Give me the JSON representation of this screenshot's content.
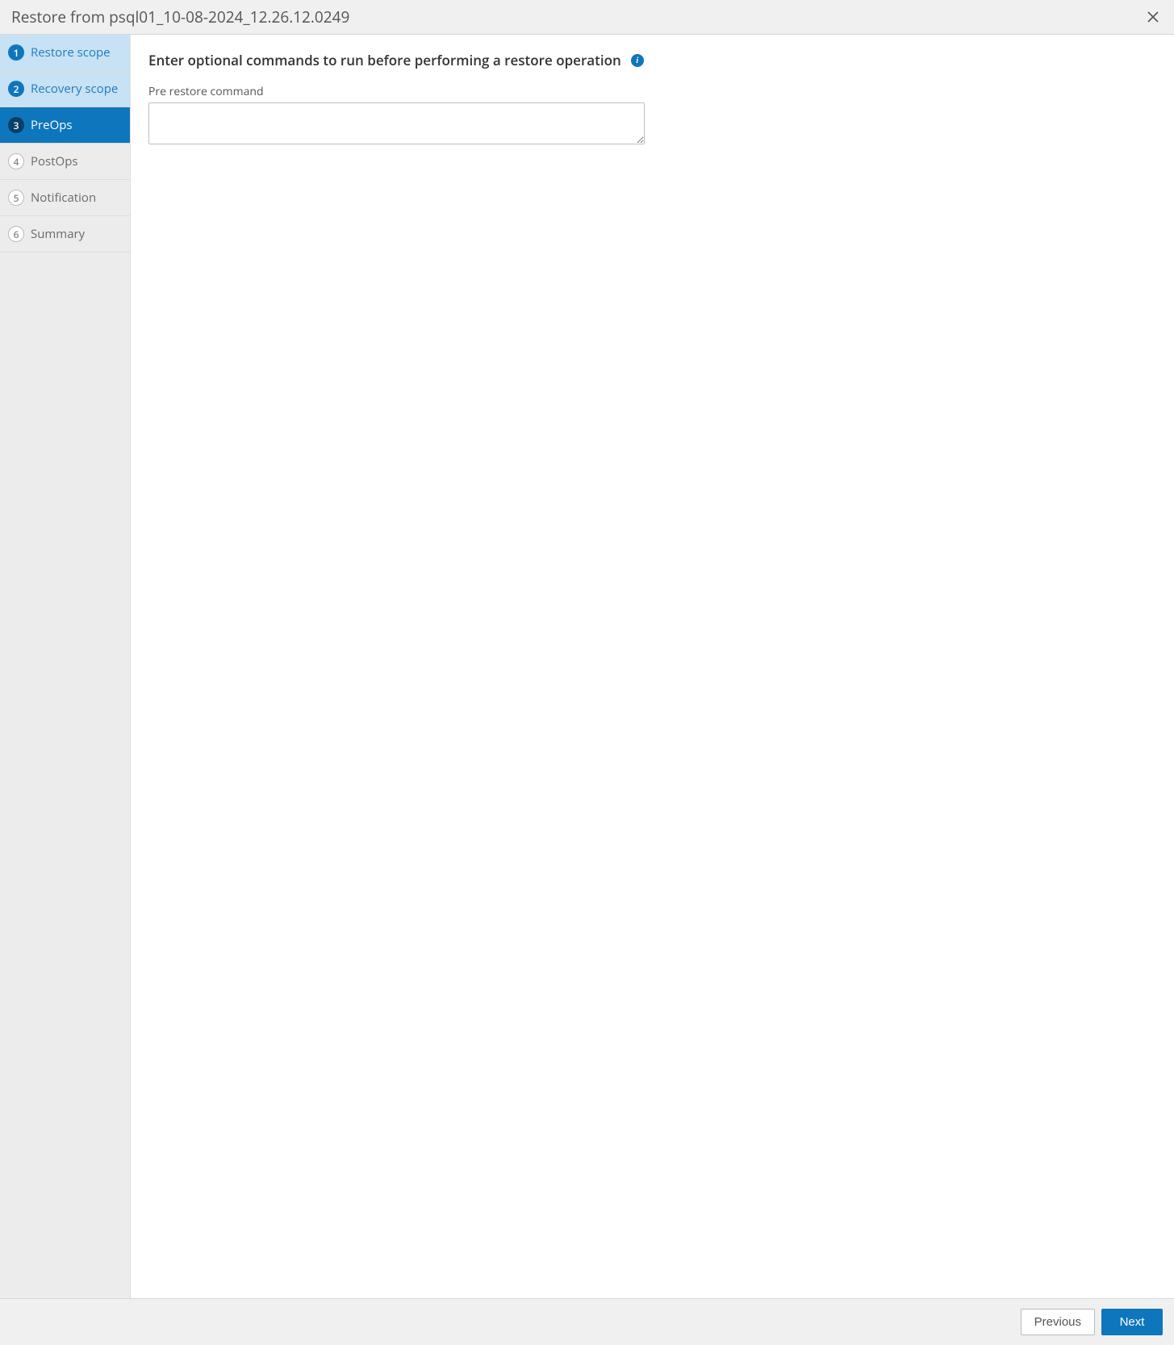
{
  "header": {
    "title": "Restore from psql01_10-08-2024_12.26.12.0249"
  },
  "sidebar": {
    "steps": [
      {
        "num": "1",
        "label": "Restore scope"
      },
      {
        "num": "2",
        "label": "Recovery scope"
      },
      {
        "num": "3",
        "label": "PreOps"
      },
      {
        "num": "4",
        "label": "PostOps"
      },
      {
        "num": "5",
        "label": "Notification"
      },
      {
        "num": "6",
        "label": "Summary"
      }
    ]
  },
  "main": {
    "heading": "Enter optional commands to run before performing a restore operation",
    "info_icon_label": "i",
    "field_label": "Pre restore command",
    "field_value": ""
  },
  "footer": {
    "previous_label": "Previous",
    "next_label": "Next"
  }
}
